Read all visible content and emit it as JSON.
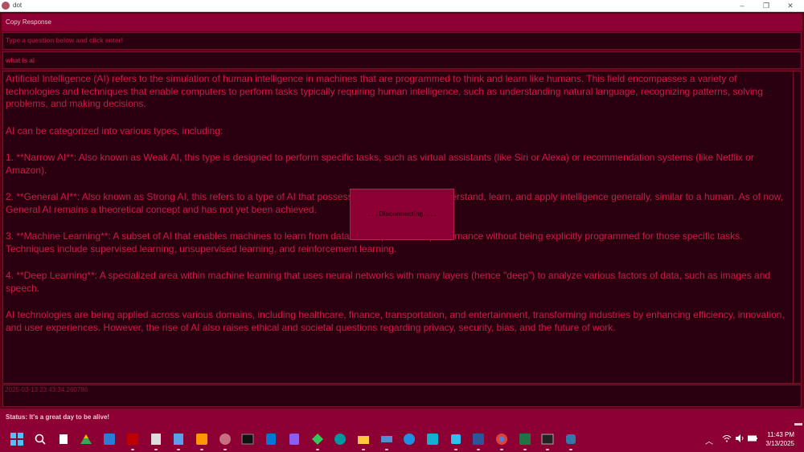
{
  "window": {
    "title": "dot",
    "minimize": "–",
    "maximize": "❐",
    "close": "✕"
  },
  "toolbar": {
    "copy_label": "Copy Response"
  },
  "prompt": {
    "label": "Type a question below and click enter!"
  },
  "question": {
    "value": "what is ai"
  },
  "response": {
    "paragraphs": [
      "Artificial Intelligence (AI) refers to the simulation of human intelligence in machines that are programmed to think and learn like humans. This field encompasses a variety of technologies and techniques that enable computers to perform tasks typically requiring human intelligence, such as understanding natural language, recognizing patterns, solving problems, and making decisions.",
      "AI can be categorized into various types, including:",
      "1. **Narrow AI**: Also known as Weak AI, this type is designed to perform specific tasks, such as virtual assistants (like Siri or Alexa) or recommendation systems (like Netflix or Amazon).",
      "2. **General AI**: Also known as Strong AI, this refers to a type of AI that possesses the capability to understand, learn, and apply intelligence generally, similar to a human. As of now, General AI remains a theoretical concept and has not yet been achieved.",
      "3. **Machine Learning**: A subset of AI that enables machines to learn from data and improve their performance without being explicitly programmed for those specific tasks. Techniques include supervised learning, unsupervised learning, and reinforcement learning.",
      "4. **Deep Learning**: A specialized area within machine learning that uses neural networks with many layers (hence \"deep\") to analyze various factors of data, such as images and speech.",
      "AI technologies are being applied across various domains, including healthcare, finance, transportation, and entertainment, transforming industries by enhancing efficiency, innovation, and user experiences. However, the rise of AI also raises ethical and societal questions regarding privacy, security, bias, and the future of work."
    ]
  },
  "timestamp": "2025-03-13 23:43:34.260786",
  "status": "Status: It's a great day to be alive!",
  "dialog": {
    "text": ". . . Disconnecting. . . ."
  },
  "taskbar": {
    "icons": [
      "windows-start-icon",
      "search-icon",
      "file-icon",
      "drive-icon",
      "remote-desktop-icon",
      "filezilla-icon",
      "editor-icon",
      "notepad-icon",
      "sublime-icon",
      "avatar-app-icon",
      "terminal-icon",
      "vscode-icon",
      "visual-studio-icon",
      "git-icon",
      "arduino-icon",
      "file-explorer-icon",
      "network-icon",
      "edge-icon",
      "power-automate-icon",
      "app-icon",
      "word-icon",
      "chrome-icon",
      "excel-icon",
      "cmd-icon",
      "python-icon"
    ],
    "clock_time": "11:43 PM",
    "clock_date": "3/13/2025"
  },
  "colors": {
    "accent": "#8c0033",
    "background": "#2a0010",
    "text": "#d01848"
  }
}
